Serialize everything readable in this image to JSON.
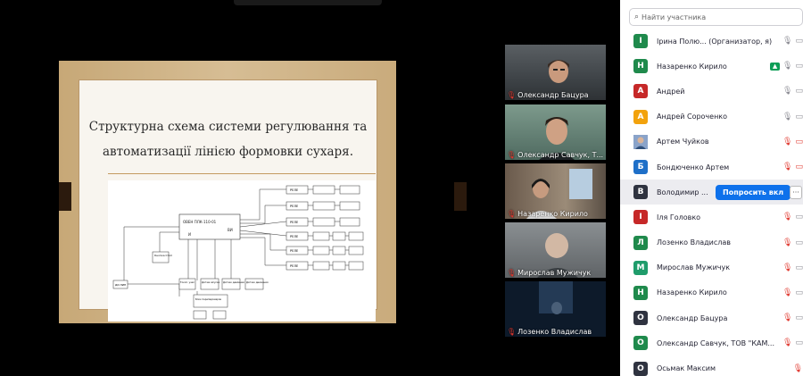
{
  "slide": {
    "title_line1": "Структурна схема системи регулювання та",
    "title_line2": "автоматизації лінією формовки сухаря.",
    "diagram": {
      "controller": "ОВЕН ПЛК-110-01",
      "controller_sub_left": "И",
      "controller_sub_right": "ВИ",
      "relay": "РЕЛЕ",
      "relays": [
        "РЕЛЕ",
        "РЕЛЕ",
        "РЕЛЕ",
        "РЕЛЕ",
        "РЕЛЕ",
        "РЕЛЕ"
      ],
      "left_block_1": "Кнопка Стоп",
      "left_block_2": "ДИ ЛИН",
      "bottom_blocks": [
        "Токоп. узел",
        "Датчик впуска",
        "Датчик давления",
        "Датчик движения"
      ],
      "bottom_center": "Блок перепадомеров"
    }
  },
  "tiles": [
    {
      "name": "Олександр Бацура"
    },
    {
      "name": "Олександр Савчук, Т..."
    },
    {
      "name": "Назаренко Кирило"
    },
    {
      "name": "Мирослав Мужичук"
    },
    {
      "name": "Лозенко Владислав"
    }
  ],
  "panel": {
    "search_placeholder": "Найти участника",
    "ask_button": "Попросить вкл",
    "more_button": "···",
    "participants": [
      {
        "initial": "І",
        "name": "Ірина Полю...  (Организатор, я)",
        "color": "#1f8a4c",
        "mic": "on",
        "video": "off"
      },
      {
        "initial": "Н",
        "name": "Назаренко Кирило",
        "color": "#1f8a4c",
        "mic": "on",
        "video": "share"
      },
      {
        "initial": "А",
        "name": "Андрей",
        "color": "#c62828",
        "mic": "on",
        "video": "off"
      },
      {
        "initial": "А",
        "name": "Андрей Сороченко",
        "color": "#f2a20c",
        "mic": "on",
        "video": "off"
      },
      {
        "initial": "",
        "name": "Артем Чуйков",
        "color": "#5b7fb5",
        "mic": "muted",
        "video": "muted",
        "photo": true
      },
      {
        "initial": "Б",
        "name": "Бондюченко Артем",
        "color": "#1e6fc8",
        "mic": "muted",
        "video": "muted"
      },
      {
        "initial": "В",
        "name": "Володимир ...",
        "color": "#2f3340",
        "mic": "muted",
        "video": "off",
        "active": true
      },
      {
        "initial": "І",
        "name": "Іля Головко",
        "color": "#c62828",
        "mic": "muted",
        "video": "off"
      },
      {
        "initial": "Л",
        "name": "Лозенко Владислав",
        "color": "#1f8a4c",
        "mic": "muted",
        "video": "off"
      },
      {
        "initial": "М",
        "name": "Мирослав Мужичук",
        "color": "#1f9c6b",
        "mic": "muted",
        "video": "off"
      },
      {
        "initial": "Н",
        "name": "Назаренко Кирило",
        "color": "#1f8a4c",
        "mic": "muted",
        "video": "off"
      },
      {
        "initial": "О",
        "name": "Олександр Бацура",
        "color": "#2f3340",
        "mic": "muted",
        "video": "off"
      },
      {
        "initial": "О",
        "name": "Олександр Савчук, ТОВ \"КАМ...",
        "color": "#1f8a4c",
        "mic": "muted",
        "video": "off"
      },
      {
        "initial": "О",
        "name": "Осьмак Максим",
        "color": "#2f3340",
        "mic": "muted",
        "video": "none"
      }
    ]
  }
}
